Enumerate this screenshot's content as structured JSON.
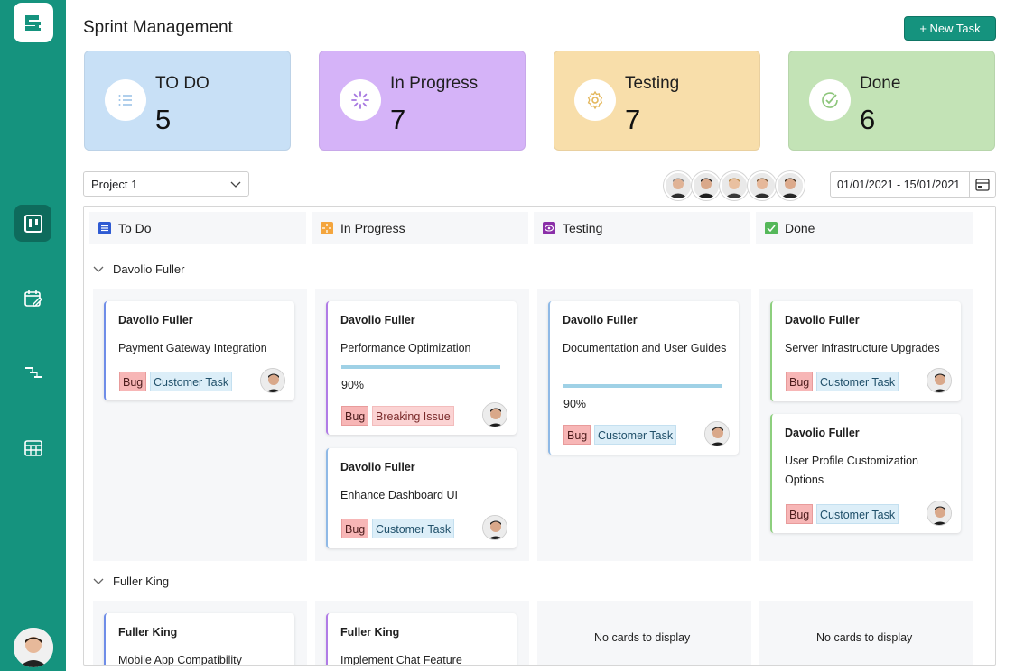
{
  "app": {
    "title": "Sprint Management",
    "new_task_label": "+ New Task"
  },
  "colors": {
    "brand": "#15937e",
    "brand_dark": "#0e6b5c",
    "todo": "#c8e0f6",
    "in_progress": "#d5b3f8",
    "testing": "#f8deaa",
    "done": "#c3e3b6"
  },
  "sidebar": {
    "items": [
      {
        "icon": "kanban-board-icon",
        "active": true
      },
      {
        "icon": "calendar-edit-icon",
        "active": false
      },
      {
        "icon": "gantt-icon",
        "active": false
      },
      {
        "icon": "grid-table-icon",
        "active": false
      }
    ]
  },
  "stats": [
    {
      "label": "TO DO",
      "count": "5",
      "icon": "list-icon"
    },
    {
      "label": "In Progress",
      "count": "7",
      "icon": "spinner-icon"
    },
    {
      "label": "Testing",
      "count": "7",
      "icon": "gear-icon"
    },
    {
      "label": "Done",
      "count": "6",
      "icon": "check-circle-icon"
    }
  ],
  "filters": {
    "project": "Project 1",
    "date_range": "01/01/2021 - 15/01/2021"
  },
  "columns": [
    {
      "title": "To Do"
    },
    {
      "title": "In Progress"
    },
    {
      "title": "Testing"
    },
    {
      "title": "Done"
    }
  ],
  "swimlanes": [
    {
      "name": "Davolio Fuller",
      "cards": {
        "todo": [
          {
            "assignee": "Davolio Fuller",
            "title": "Payment Gateway Integration",
            "tags": [
              "Bug",
              "Customer Task"
            ]
          }
        ],
        "in_progress": [
          {
            "assignee": "Davolio Fuller",
            "title": "Performance Optimization",
            "progress": "90%",
            "progress_value": 0.9,
            "tags": [
              "Bug",
              "Breaking Issue"
            ]
          },
          {
            "assignee": "Davolio Fuller",
            "title": "Enhance Dashboard UI",
            "tags": [
              "Bug",
              "Customer Task"
            ]
          }
        ],
        "testing": [
          {
            "assignee": "Davolio Fuller",
            "title": "Documentation and User Guides",
            "progress": "90%",
            "progress_value": 0.9,
            "tags": [
              "Bug",
              "Customer Task"
            ]
          }
        ],
        "done": [
          {
            "assignee": "Davolio Fuller",
            "title": "Server Infrastructure Upgrades",
            "tags": [
              "Bug",
              "Customer Task"
            ]
          },
          {
            "assignee": "Davolio Fuller",
            "title": "User Profile Customization Options",
            "tags": [
              "Bug",
              "Customer Task"
            ]
          }
        ]
      }
    },
    {
      "name": "Fuller King",
      "cards": {
        "todo": [
          {
            "assignee": "Fuller King",
            "title": "Mobile App Compatibility"
          }
        ],
        "in_progress": [
          {
            "assignee": "Fuller King",
            "title": "Implement Chat Feature"
          }
        ],
        "testing_empty": "No cards to display",
        "done_empty": "No cards to display"
      }
    }
  ]
}
